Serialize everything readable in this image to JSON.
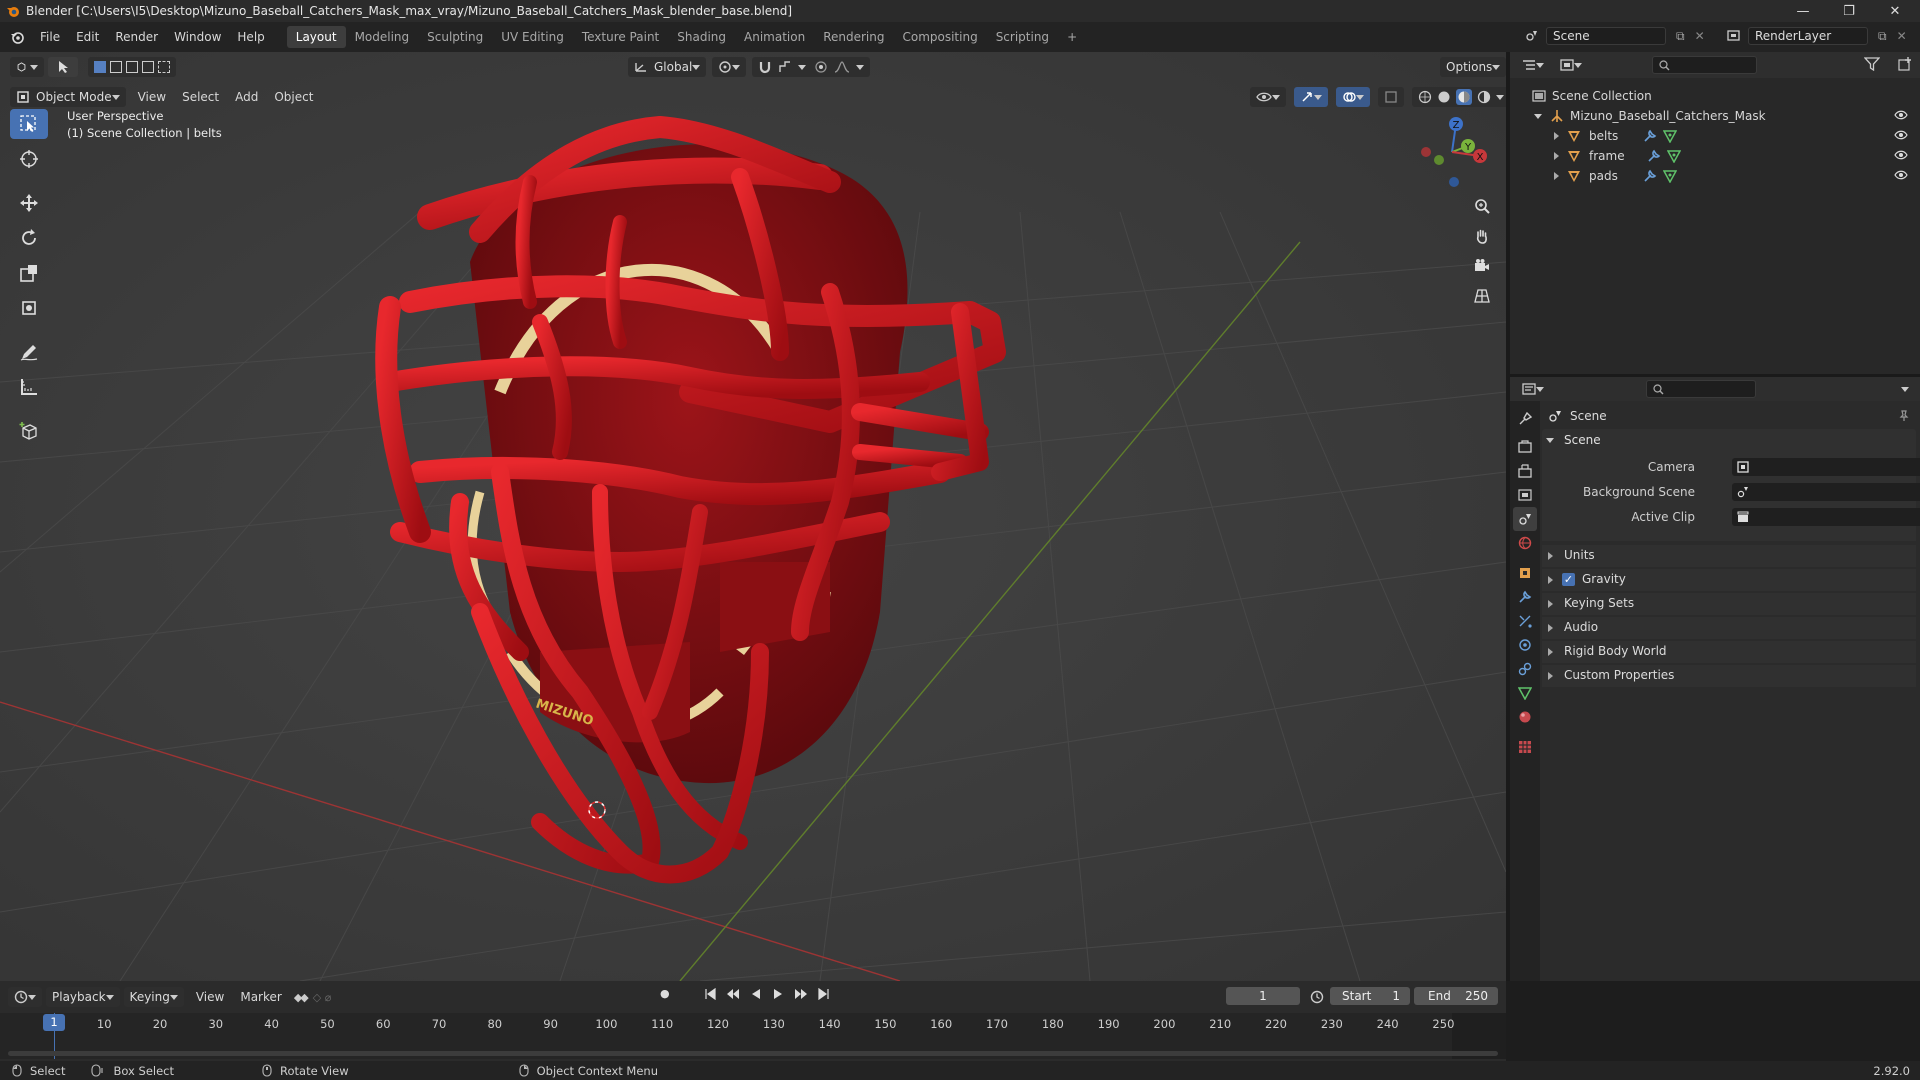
{
  "title_bar": {
    "title": "Blender [C:\\Users\\I5\\Desktop\\Mizuno_Baseball_Catchers_Mask_max_vray/Mizuno_Baseball_Catchers_Mask_blender_base.blend]",
    "minimize": "—",
    "maximize": "❐",
    "close": "✕"
  },
  "menu": [
    "File",
    "Edit",
    "Render",
    "Window",
    "Help"
  ],
  "workspaces": [
    "Layout",
    "Modeling",
    "Sculpting",
    "UV Editing",
    "Texture Paint",
    "Shading",
    "Animation",
    "Rendering",
    "Compositing",
    "Scripting"
  ],
  "active_workspace": "Layout",
  "add_workspace": "+",
  "scene_field": "Scene",
  "render_layer_field": "RenderLayer",
  "viewport": {
    "mode": "Object Mode",
    "menus": [
      "View",
      "Select",
      "Add",
      "Object"
    ],
    "transform_orientation": "Global",
    "options": "Options",
    "perspective": "User Perspective",
    "collection_info": "(1) Scene Collection | belts",
    "gizmo_axes": {
      "z": "Z",
      "y": "Y",
      "x": "X"
    },
    "logo_text": "MIZUNO"
  },
  "outliner": {
    "root": "Scene Collection",
    "collection": "Mizuno_Baseball_Catchers_Mask",
    "objects": [
      "belts",
      "frame",
      "pads"
    ]
  },
  "properties": {
    "header": "Scene",
    "panel": "Scene",
    "fields": [
      {
        "label": "Camera",
        "value": ""
      },
      {
        "label": "Background Scene",
        "value": ""
      },
      {
        "label": "Active Clip",
        "value": ""
      }
    ],
    "sections": [
      "Units",
      "Gravity",
      "Keying Sets",
      "Audio",
      "Rigid Body World",
      "Custom Properties"
    ],
    "gravity_checked": true
  },
  "timeline": {
    "menus": [
      "Playback",
      "Keying",
      "View",
      "Marker"
    ],
    "current_frame": "1",
    "start_label": "Start",
    "start": "1",
    "end_label": "End",
    "end": "250",
    "frame_indicator": "1",
    "ticks": [
      "10",
      "20",
      "30",
      "40",
      "50",
      "60",
      "70",
      "80",
      "90",
      "100",
      "110",
      "120",
      "130",
      "140",
      "150",
      "160",
      "170",
      "180",
      "190",
      "200",
      "210",
      "220",
      "230",
      "240",
      "250"
    ]
  },
  "status_bar": {
    "items": [
      "Select",
      "Box Select",
      "Rotate View",
      "Object Context Menu"
    ],
    "version": "2.92.0"
  },
  "colors": {
    "accent": "#4772b3",
    "mask_red": "#c4161c",
    "pad_cream": "#e8d29a",
    "x_axis": "#c7383b",
    "y_axis": "#7ab33c"
  }
}
